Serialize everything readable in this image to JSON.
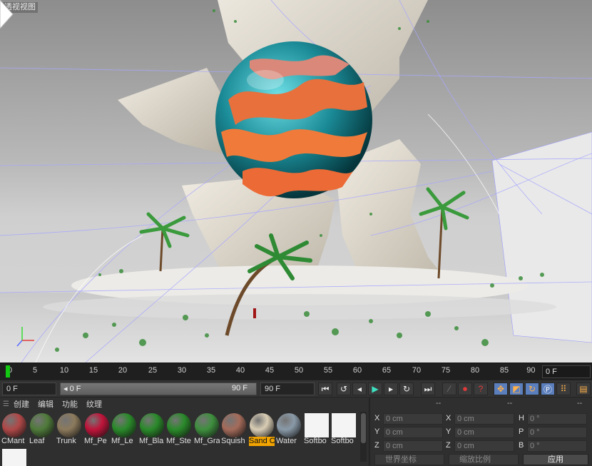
{
  "viewport": {
    "label": "透视视图"
  },
  "timeline": {
    "ticks": [
      "0",
      "5",
      "10",
      "15",
      "20",
      "25",
      "30",
      "35",
      "40",
      "45",
      "50",
      "55",
      "60",
      "65",
      "70",
      "75",
      "80",
      "85",
      "90"
    ],
    "current_frame": "0 F"
  },
  "transport": {
    "start_frame": "0 F",
    "range_start": "0 F",
    "range_end": "90 F",
    "end_frame": "90 F"
  },
  "materials": {
    "menu": [
      "创建",
      "编辑",
      "功能",
      "纹理"
    ],
    "items": [
      {
        "name": "CMant",
        "color": "#b04848",
        "selected": false
      },
      {
        "name": "Leaf",
        "color": "#4f7a3a",
        "selected": false
      },
      {
        "name": "Trunk",
        "color": "#8c7a5c",
        "selected": false
      },
      {
        "name": "Mf_Pe",
        "color": "#c0143a",
        "selected": false
      },
      {
        "name": "Mf_Le",
        "color": "#2a8a2a",
        "selected": false
      },
      {
        "name": "Mf_Bla",
        "color": "#2a8a2a",
        "selected": false
      },
      {
        "name": "Mf_Ste",
        "color": "#2a8a2a",
        "selected": false
      },
      {
        "name": "Mf_Gra",
        "color": "#3e8f3e",
        "selected": false
      },
      {
        "name": "Squish",
        "color": "#a46b5a",
        "selected": false
      },
      {
        "name": "Sand C",
        "color": "#d9cdb4",
        "selected": true
      },
      {
        "name": "Water",
        "color": "#8a9aa8",
        "selected": false
      },
      {
        "name": "Softbo",
        "color": "#f4f4f4",
        "selected": false
      },
      {
        "name": "Softbo",
        "color": "#f4f4f4",
        "selected": false
      },
      {
        "name": "",
        "color": "#f4f4f4",
        "selected": false
      }
    ]
  },
  "coordinates": {
    "headers": [
      "--",
      "--",
      "--"
    ],
    "position": [
      {
        "axis": "X",
        "value": "0 cm"
      },
      {
        "axis": "Y",
        "value": "0 cm"
      },
      {
        "axis": "Z",
        "value": "0 cm"
      }
    ],
    "size": [
      {
        "axis": "X",
        "value": "0 cm"
      },
      {
        "axis": "Y",
        "value": "0 cm"
      },
      {
        "axis": "Z",
        "value": "0 cm"
      }
    ],
    "rotation": [
      {
        "axis": "H",
        "value": "0 °"
      },
      {
        "axis": "P",
        "value": "0 °"
      },
      {
        "axis": "B",
        "value": "0 °"
      }
    ],
    "mode_select": "世界坐标",
    "scale_select": "缩放比例",
    "apply_label": "应用"
  }
}
